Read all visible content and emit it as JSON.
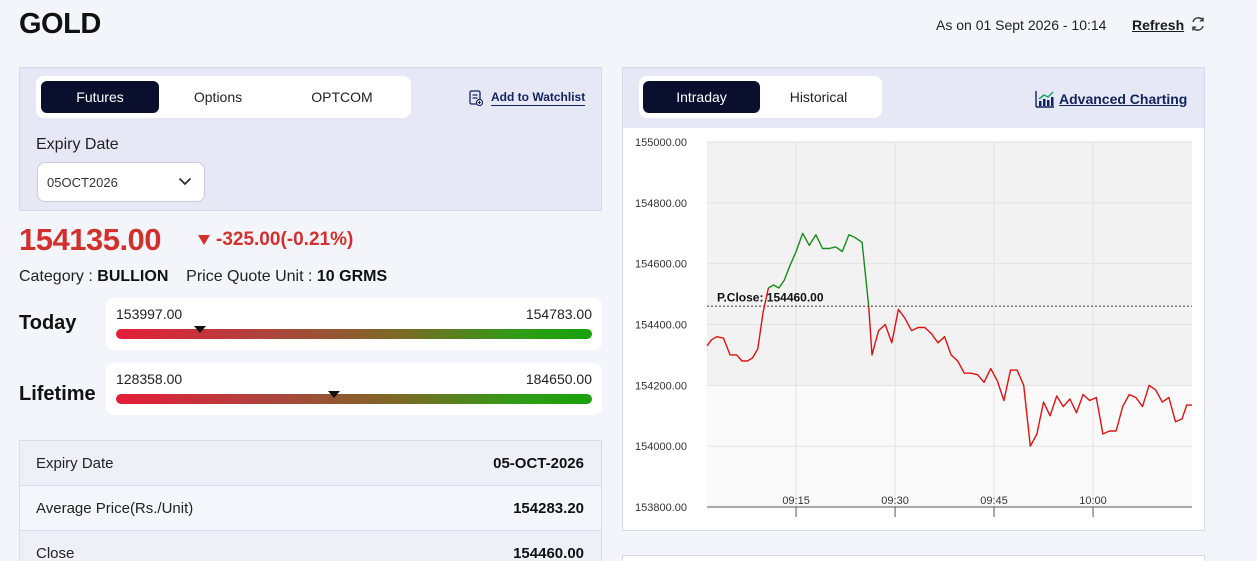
{
  "header": {
    "title": "GOLD",
    "as_on": "As on 01 Sept 2026 - 10:14",
    "refresh_label": "Refresh"
  },
  "left": {
    "tabs": [
      "Futures",
      "Options",
      "OPTCOM"
    ],
    "active_tab": "Futures",
    "watchlist_label": "Add to Watchlist",
    "expiry_label": "Expiry Date",
    "expiry_value": "05OCT2026",
    "price": "154135.00",
    "change": "-325.00(-0.21%)",
    "category_label": "Category :",
    "category_value": "BULLION",
    "unit_label": "Price Quote Unit :",
    "unit_value": "10 GRMS",
    "today": {
      "label": "Today",
      "low": "153997.00",
      "high": "154783.00",
      "current": 154135
    },
    "lifetime": {
      "label": "Lifetime",
      "low": "128358.00",
      "high": "184650.00",
      "current": 154135
    },
    "table": [
      {
        "key": "Expiry Date",
        "value": "05-OCT-2026"
      },
      {
        "key": "Average Price(Rs./Unit)",
        "value": "154283.20"
      },
      {
        "key": "Close",
        "value": "154460.00"
      }
    ]
  },
  "right": {
    "tabs": [
      "Intraday",
      "Historical"
    ],
    "active_tab": "Intraday",
    "advanced_label": "Advanced Charting"
  },
  "colors": {
    "accent": "#0b0f2e",
    "down": "#d0312d",
    "up": "#1a8a1a",
    "link": "#13235b"
  },
  "chart_data": {
    "type": "line",
    "y_ticks": [
      "155000.00",
      "154800.00",
      "154600.00",
      "154400.00",
      "154200.00",
      "154000.00",
      "153800.00"
    ],
    "ylim": [
      153800,
      155000
    ],
    "x_ticks": [
      {
        "label": "09:15",
        "t": 15
      },
      {
        "label": "09:30",
        "t": 30
      },
      {
        "label": "09:45",
        "t": 45
      },
      {
        "label": "10:00",
        "t": 60
      }
    ],
    "xlim": [
      1.5,
      75
    ],
    "reference": {
      "label": "P.Close:",
      "value_label": "154460.00",
      "value": 154460
    },
    "series": [
      {
        "color": "#dd1111",
        "points": [
          [
            1.5,
            154330
          ],
          [
            2.2,
            154350
          ],
          [
            3,
            154360
          ],
          [
            4,
            154355
          ],
          [
            5,
            154300
          ],
          [
            6,
            154300
          ],
          [
            6.8,
            154280
          ],
          [
            7.6,
            154280
          ],
          [
            8.4,
            154290
          ],
          [
            9.2,
            154320
          ],
          [
            10,
            154440
          ],
          [
            10.8,
            154520
          ]
        ]
      },
      {
        "color": "#1a8a1a",
        "points": [
          [
            10.8,
            154520
          ],
          [
            11.6,
            154530
          ],
          [
            12.4,
            154520
          ],
          [
            13.2,
            154545
          ],
          [
            14,
            154590
          ],
          [
            15,
            154640
          ],
          [
            16,
            154700
          ],
          [
            17,
            154660
          ],
          [
            18,
            154695
          ],
          [
            19,
            154650
          ],
          [
            20,
            154650
          ],
          [
            21,
            154655
          ],
          [
            22,
            154640
          ],
          [
            23,
            154695
          ],
          [
            24,
            154685
          ],
          [
            25,
            154670
          ],
          [
            26,
            154460
          ]
        ]
      },
      {
        "color": "#dd1111",
        "points": [
          [
            26,
            154460
          ],
          [
            26.5,
            154300
          ],
          [
            27.5,
            154380
          ],
          [
            28.5,
            154400
          ],
          [
            29.5,
            154340
          ],
          [
            30.5,
            154450
          ],
          [
            31.5,
            154420
          ],
          [
            32.5,
            154380
          ],
          [
            33.5,
            154390
          ],
          [
            34.5,
            154390
          ],
          [
            35.5,
            154370
          ],
          [
            36.5,
            154340
          ],
          [
            37.5,
            154360
          ],
          [
            38.5,
            154300
          ],
          [
            39.5,
            154280
          ],
          [
            40.5,
            154240
          ],
          [
            41.5,
            154240
          ],
          [
            42.5,
            154235
          ],
          [
            43.5,
            154210
          ],
          [
            44.5,
            154255
          ],
          [
            45.5,
            154215
          ],
          [
            46.5,
            154150
          ],
          [
            47.5,
            154250
          ],
          [
            48.5,
            154250
          ],
          [
            49.5,
            154200
          ],
          [
            50.5,
            154000
          ],
          [
            51.5,
            154040
          ],
          [
            52.5,
            154145
          ],
          [
            53.5,
            154100
          ],
          [
            54.5,
            154165
          ],
          [
            55.5,
            154130
          ],
          [
            56.5,
            154155
          ],
          [
            57.5,
            154110
          ],
          [
            58.5,
            154170
          ],
          [
            59.5,
            154150
          ],
          [
            60.5,
            154160
          ],
          [
            61.5,
            154040
          ],
          [
            62.5,
            154050
          ],
          [
            63.5,
            154050
          ],
          [
            64.5,
            154130
          ],
          [
            65.5,
            154170
          ],
          [
            66.5,
            154160
          ],
          [
            67.5,
            154130
          ],
          [
            68.5,
            154200
          ],
          [
            69.5,
            154185
          ],
          [
            70.5,
            154145
          ],
          [
            71.5,
            154160
          ],
          [
            72.5,
            154080
          ],
          [
            73.5,
            154090
          ],
          [
            74.2,
            154135
          ],
          [
            75,
            154135
          ]
        ]
      }
    ]
  }
}
